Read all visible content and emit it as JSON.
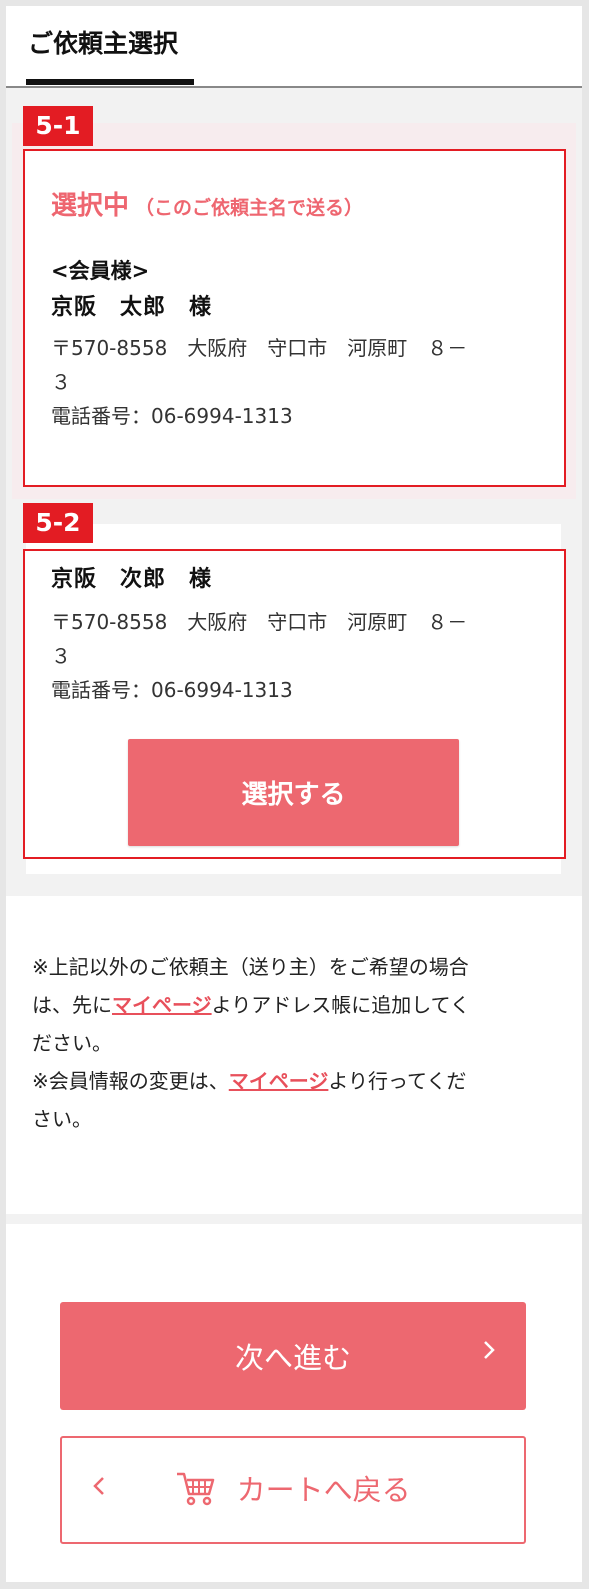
{
  "header": {
    "title": "ご依頼主選択"
  },
  "card1": {
    "badge": "5-1",
    "status_main": "選択中",
    "status_sub": "（このご依頼主名で送る）",
    "member_label": "<会員様>",
    "name": "京阪　太郎　様",
    "address_line1": "〒570-8558　大阪府　守口市　河原町　８－",
    "address_line2": "３",
    "phone": "電話番号：06-6994-1313"
  },
  "card2": {
    "badge": "5-2",
    "name": "京阪　次郎　様",
    "address_line1": "〒570-8558　大阪府　守口市　河原町　８－",
    "address_line2": "３",
    "phone": "電話番号：06-6994-1313",
    "select_button": "選択する"
  },
  "notes": {
    "line1_a": "※上記以外のご依頼主（送り主）をご希望の場合",
    "line2_a": "は、先に",
    "link1": "マイページ",
    "line2_b": "よりアドレス帳に追加してく",
    "line3": "ださい。",
    "line4_a": "※会員情報の変更は、",
    "link2": "マイページ",
    "line4_b": "より行ってくだ",
    "line5": "さい。"
  },
  "footer": {
    "next_button": "次へ進む",
    "next_icon": "chevron-right-icon",
    "back_button": "カートへ戻る",
    "back_icon": "chevron-left-icon",
    "cart_icon": "cart-icon"
  },
  "colors": {
    "accent": "#ed6870",
    "badge_red": "#e31c23",
    "link": "#e8505b"
  }
}
